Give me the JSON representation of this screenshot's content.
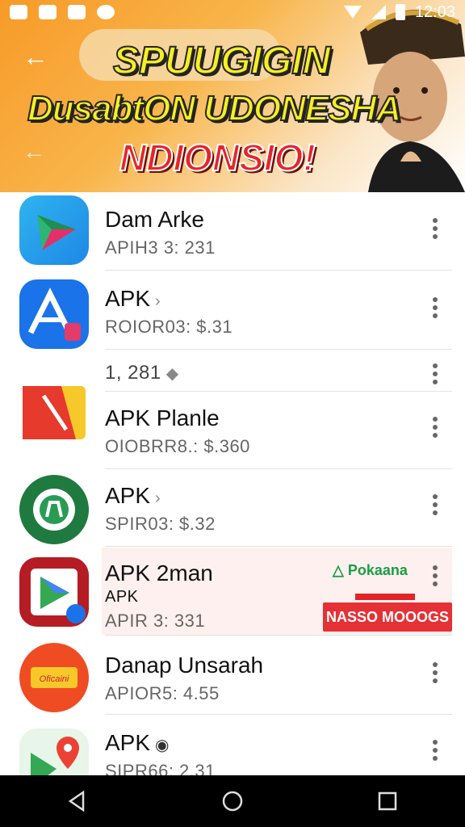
{
  "status_bar": {
    "time": "12:03"
  },
  "header": {
    "line1": "SPUUGIGIN",
    "line2": "DusabtON UDONESHA",
    "line3": "NDIONSIO!",
    "colors": {
      "title_yellow": "#f6ef23",
      "title_red": "#e5262a",
      "banner_orange": "#f79a28"
    }
  },
  "apps": [
    {
      "name": "Dam Arke",
      "sub": "APIH3 3: 231",
      "icon": "green-triangle-icon"
    },
    {
      "name": "APK",
      "sub": "ROIOR03: $.31",
      "icon": "blue-a-icon"
    },
    {
      "name": "1, 281",
      "sub": "",
      "icon": ""
    },
    {
      "name": "APK Planle",
      "sub": "OIOBRR8.: $.360",
      "icon": "red-yellow-icon"
    },
    {
      "name": "APK",
      "sub": "SPIR03: $.32",
      "icon": "green-gear-icon"
    },
    {
      "name": "APK 2man",
      "sub2": "APK",
      "sub": "APIR 3: 331",
      "icon": "play-store-icon"
    },
    {
      "name": "Danap Unsarah",
      "sub": "APIOR5: 4.55",
      "icon": "orange-circle-icon"
    },
    {
      "name": "APK",
      "sub": "SIPR66: 2.31",
      "icon": "map-pin-icon"
    }
  ],
  "promo": {
    "tag": "Pokaana",
    "button": "NASSO MOOOGS"
  }
}
